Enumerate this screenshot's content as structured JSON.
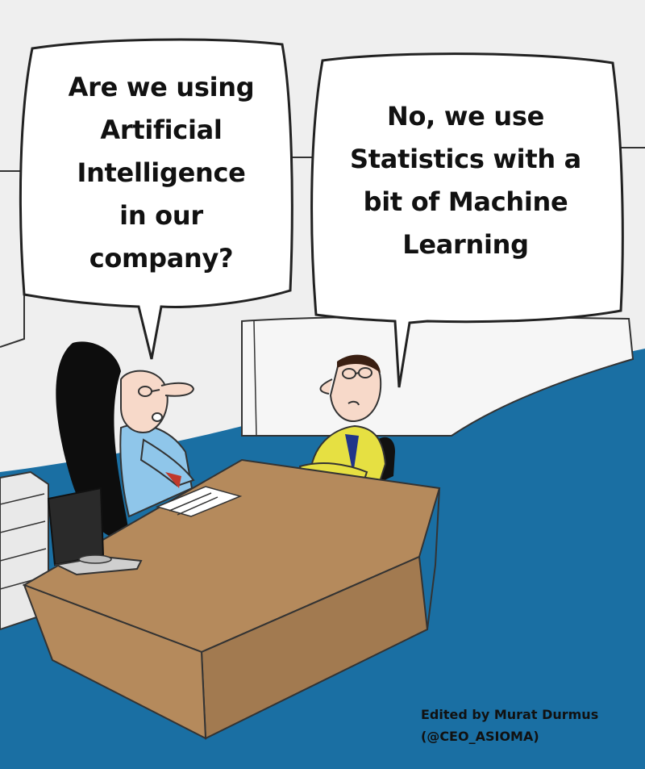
{
  "cartoon": {
    "speech_left": "Are we using\nArtificial\nIntelligence\nin our\ncompany?",
    "speech_right": "No, we use\nStatistics with a\nbit of Machine\nLearning",
    "credit_line1": "Edited by Murat Durmus",
    "credit_line2": "(@CEO_ASIOMA)"
  },
  "colors": {
    "wall": "#efefef",
    "floor": "#1a6fa3",
    "desk": "#b58a5c",
    "desk_side": "#a27a50",
    "shirt_left": "#8fc6ea",
    "shirt_right": "#e6e042",
    "hair": "#0d0d0d",
    "skin": "#f7d9c9"
  }
}
